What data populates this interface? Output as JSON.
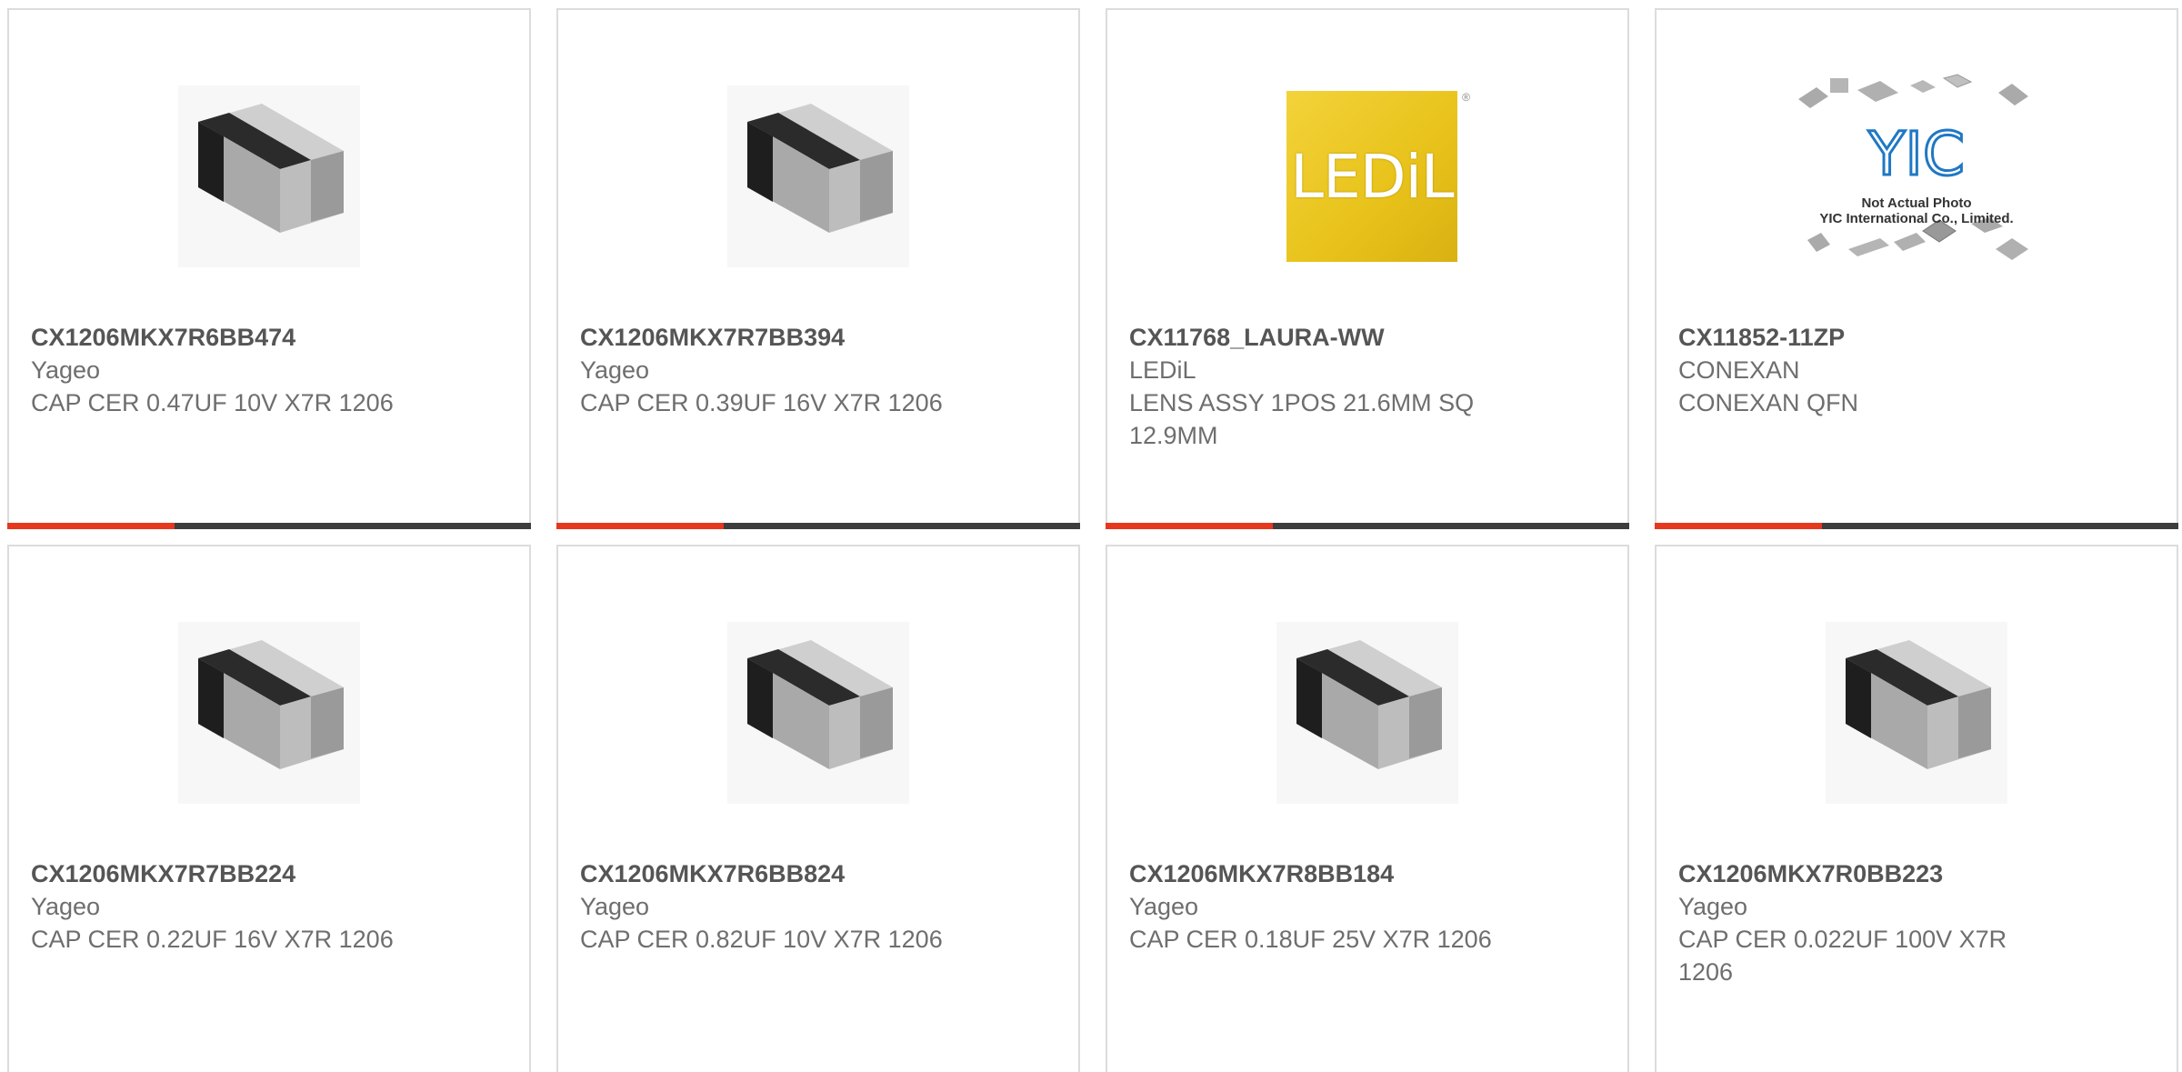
{
  "products": [
    {
      "part": "CX1206MKX7R6BB474",
      "manufacturer": "Yageo",
      "description": "CAP CER 0.47UF 10V X7R 1206",
      "image": "ceramic-capacitor-chip"
    },
    {
      "part": "CX1206MKX7R7BB394",
      "manufacturer": "Yageo",
      "description": "CAP CER 0.39UF 16V X7R 1206",
      "image": "ceramic-capacitor-chip"
    },
    {
      "part": "CX11768_LAURA-WW",
      "manufacturer": "LEDiL",
      "description": "LENS ASSY 1POS 21.6MM SQ 12.9MM",
      "image": "ledil-logo",
      "logo_text": "LEDiL"
    },
    {
      "part": "CX11852-11ZP",
      "manufacturer": "CONEXAN",
      "description": "CONEXAN QFN",
      "image": "yic-placeholder",
      "logo_text": "YIC",
      "image_caption": "Not Actual Photo",
      "image_caption2": "YIC International Co., Limited."
    },
    {
      "part": "CX1206MKX7R7BB224",
      "manufacturer": "Yageo",
      "description": "CAP CER 0.22UF 16V X7R 1206",
      "image": "ceramic-capacitor-chip"
    },
    {
      "part": "CX1206MKX7R6BB824",
      "manufacturer": "Yageo",
      "description": "CAP CER 0.82UF 10V X7R 1206",
      "image": "ceramic-capacitor-chip"
    },
    {
      "part": "CX1206MKX7R8BB184",
      "manufacturer": "Yageo",
      "description": "CAP CER 0.18UF 25V X7R 1206",
      "image": "ceramic-capacitor-chip"
    },
    {
      "part": "CX1206MKX7R0BB223",
      "manufacturer": "Yageo",
      "description": "CAP CER 0.022UF 100V X7R 1206",
      "image": "ceramic-capacitor-chip"
    }
  ],
  "colors": {
    "accent": "#e5381e",
    "bar": "#3d3d3d",
    "border": "#dcdcdc",
    "part_text": "#555555",
    "body_text": "#6e6e6e",
    "ledil_yellow": "#e8c21a",
    "yic_blue": "#1f78c4"
  }
}
